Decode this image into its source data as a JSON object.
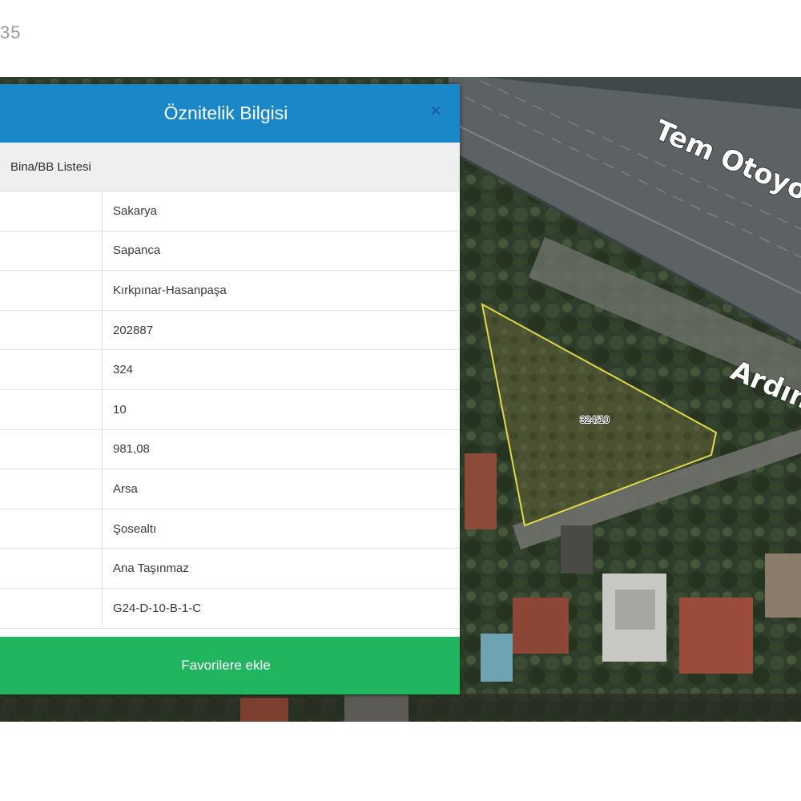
{
  "page": {
    "corner_number": "35"
  },
  "map": {
    "road_label_1": "Tem Otoyoru",
    "road_label_2": "Ardınç",
    "parcel_label": "324/10",
    "parcel_outline_color": "#e3d84a"
  },
  "popup": {
    "title": "Öznitelik Bilgisi",
    "close_icon": "close-icon",
    "tab_label": "Bina/BB Listesi",
    "rows": [
      {
        "value": "Sakarya"
      },
      {
        "value": "Sapanca"
      },
      {
        "value": "Kırkpınar-Hasanpaşa"
      },
      {
        "value": "202887"
      },
      {
        "value": "324"
      },
      {
        "value": "10"
      },
      {
        "value": "981,08"
      },
      {
        "value": "Arsa"
      },
      {
        "value": "Şosealtı"
      },
      {
        "value": "Ana Taşınmaz"
      },
      {
        "value": "G24-D-10-B-1-C"
      }
    ],
    "favorite_button": "Favorilere ekle",
    "header_color": "#1a87c9",
    "button_color": "#22b55f"
  }
}
